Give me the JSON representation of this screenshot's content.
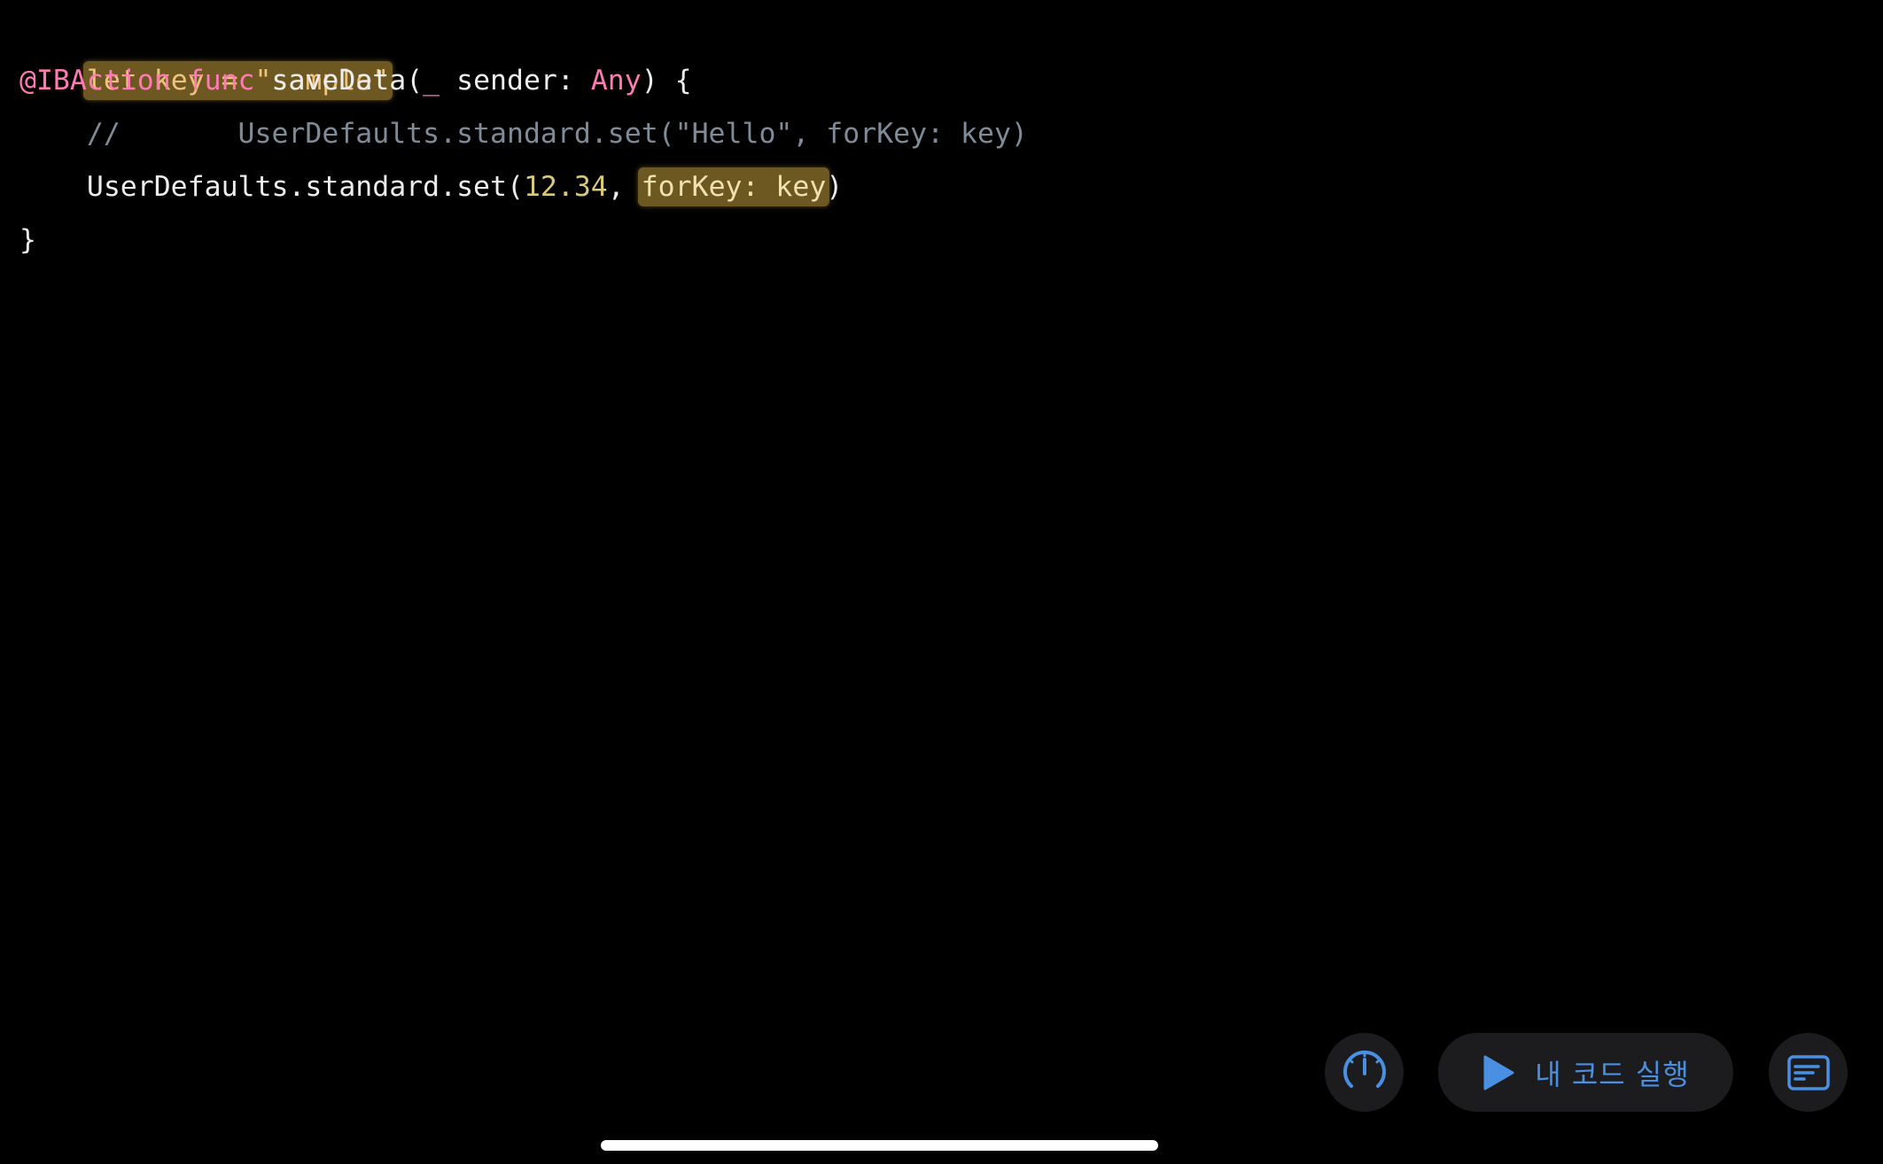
{
  "code": {
    "line1": {
      "kw_let": "let",
      "rest": " key = \"sample\""
    },
    "line2": {
      "attribute": "@IBAction",
      "kw_func": "func",
      "name": " saveData(",
      "underscore": "_",
      "param": " sender: ",
      "type_any": "Any",
      "tail": ") {"
    },
    "line3": {
      "comment": "    //       UserDefaults.standard.set(\"Hello\", forKey: key)"
    },
    "line4": {
      "prefix": "    UserDefaults.standard.set(",
      "number": "12.34",
      "comma": ", ",
      "highlight": "forKey: key",
      "tail": ")"
    },
    "line5": {
      "brace": "}"
    }
  },
  "toolbar": {
    "gauge_icon": "speedometer-icon",
    "run_icon": "play-icon",
    "run_label": "내 코드 실행",
    "panel_icon": "text-panel-icon"
  },
  "colors": {
    "background": "#000000",
    "keyword": "#ff7ab2",
    "number": "#d9c97c",
    "comment": "#7f8c98",
    "highlight": "#c8a03c",
    "accent": "#4a90e2",
    "button_bg": "#1c1c1e"
  }
}
